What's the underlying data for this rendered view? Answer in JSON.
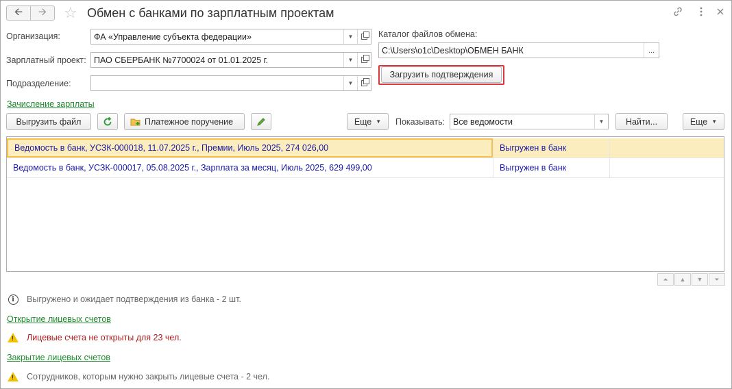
{
  "window": {
    "title": "Обмен с банками по зарплатным проектам"
  },
  "form": {
    "org_label": "Организация:",
    "org_value": "ФА «Управление субъекта федерации»",
    "project_label": "Зарплатный проект:",
    "project_value": "ПАО СБЕРБАНК №7700024 от 01.01.2025 г.",
    "dept_label": "Подразделение:",
    "dept_value": "",
    "catalog_label": "Каталог файлов обмена:",
    "catalog_value": "C:\\Users\\o1c\\Desktop\\ОБМЕН БАНК",
    "browse_label": "...",
    "load_button": "Загрузить подтверждения"
  },
  "salary_link": "Зачисление зарплаты",
  "toolbar": {
    "export_file": "Выгрузить файл",
    "payment_order": "Платежное поручение",
    "more1": "Еще",
    "show_label": "Показывать:",
    "show_value": "Все ведомости",
    "find": "Найти...",
    "more2": "Еще"
  },
  "grid": {
    "rows": [
      {
        "name": "Ведомость в банк, УСЗК-000018, 11.07.2025 г., Премии, Июль 2025, 274 026,00",
        "status": "Выгружен в банк",
        "selected": true
      },
      {
        "name": "Ведомость в банк, УСЗК-000017, 05.08.2025 г., Зарплата за месяц, Июль 2025, 629 499,00",
        "status": "Выгружен в банк",
        "selected": false
      }
    ]
  },
  "messages": {
    "awaiting": "Выгружено и ожидает подтверждения из банка - 2 шт.",
    "open_accounts_link": "Открытие лицевых счетов",
    "not_opened": "Лицевые счета не открыты для 23 чел.",
    "close_accounts_link": "Закрытие лицевых счетов",
    "to_close": "Сотрудников, которым нужно закрыть лицевые счета - 2 чел."
  },
  "colors": {
    "link": "#1f8a2e",
    "row_text": "#1a1aa6",
    "selected_row": "#fbedbd",
    "highlight_border": "#d9363e",
    "error_text": "#b01c1c",
    "muted_text": "#666666"
  }
}
